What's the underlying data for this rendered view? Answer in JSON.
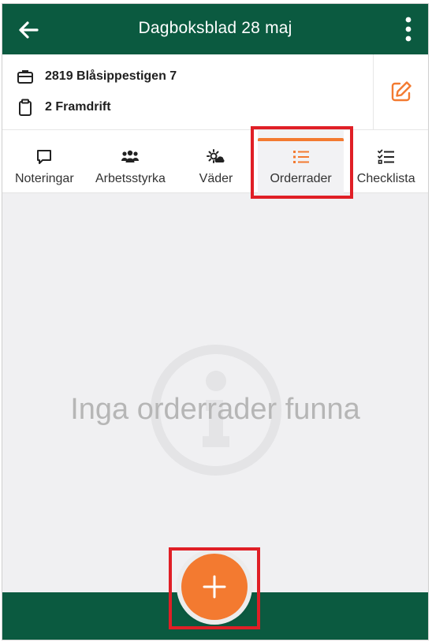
{
  "header": {
    "title": "Dagboksblad 28 maj",
    "back_icon": "arrow-left-icon",
    "more_icon": "more-vertical-icon"
  },
  "info": {
    "project": "2819 Blåsippestigen 7",
    "project_icon": "briefcase-icon",
    "phase": "2 Framdrift",
    "phase_icon": "clipboard-icon",
    "edit_icon": "edit-icon"
  },
  "tabs": [
    {
      "label": "Noteringar",
      "icon": "comment-icon",
      "active": false
    },
    {
      "label": "Arbetsstyrka",
      "icon": "users-icon",
      "active": false
    },
    {
      "label": "Väder",
      "icon": "weather-icon",
      "active": false
    },
    {
      "label": "Orderrader",
      "icon": "list-icon",
      "active": true
    },
    {
      "label": "Checklista",
      "icon": "checklist-icon",
      "active": false
    }
  ],
  "empty_state": {
    "message": "Inga orderrader funna",
    "icon": "info-icon"
  },
  "fab": {
    "icon": "plus-icon"
  },
  "colors": {
    "primary": "#0b5a40",
    "accent": "#f37a30",
    "highlight": "#e01f26"
  }
}
